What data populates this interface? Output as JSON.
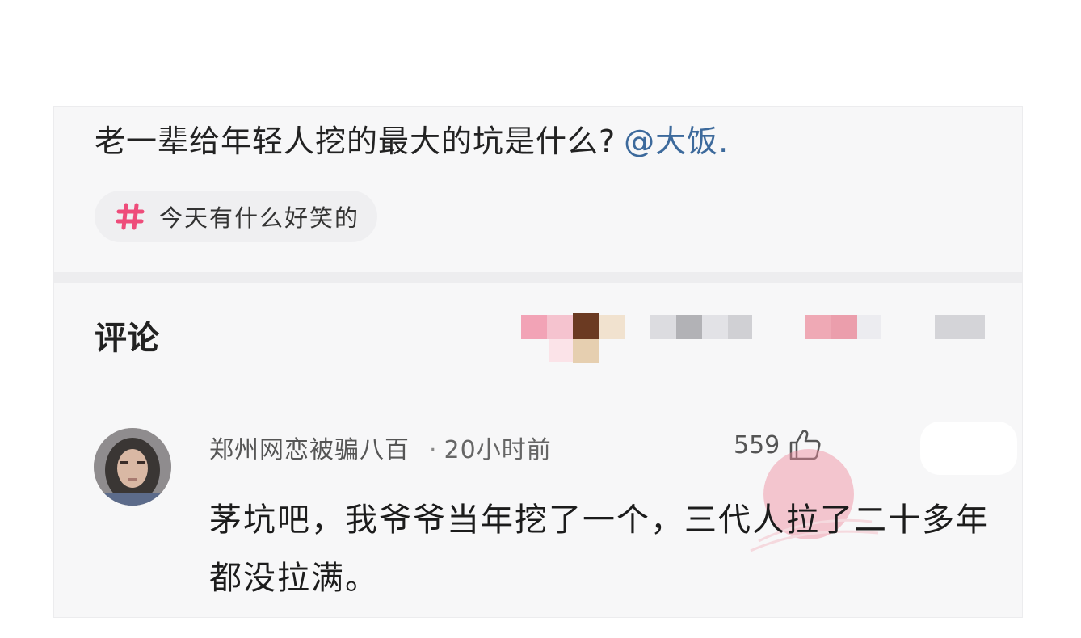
{
  "post": {
    "title": "老一辈给年轻人挖的最大的坑是什么?",
    "mention": "@大饭."
  },
  "topic": {
    "icon": "hashtag-icon",
    "label": "今天有什么好笑的"
  },
  "comments_section": {
    "heading": "评论"
  },
  "comment": {
    "username": "郑州网恋被骗八百",
    "separator": "·",
    "time": "20小时前",
    "likes": "559",
    "like_icon": "thumbs-up-icon",
    "text": "茅坑吧，我爷爷当年挖了一个，三代人拉了二十多年都没拉满。"
  },
  "colors": {
    "accent_pink": "#ee4c7a",
    "mention_blue": "#3d6a9c"
  }
}
